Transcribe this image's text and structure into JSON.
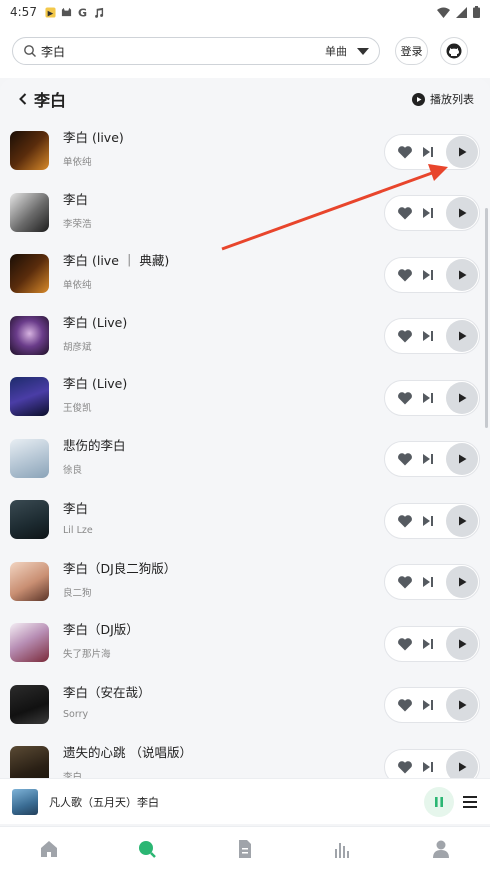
{
  "status_bar": {
    "time": "4:57",
    "notification_icons": [
      "notification-badge-icon",
      "cat-icon",
      "google-icon",
      "music-note-icon"
    ],
    "system_icons": [
      "wifi-icon",
      "signal-icon",
      "battery-icon"
    ]
  },
  "search": {
    "query": "李白",
    "type_label": "单曲"
  },
  "header": {
    "login_label": "登录"
  },
  "panel": {
    "title": "李白",
    "playlist_label": "播放列表"
  },
  "songs": [
    {
      "title": "李白 (live)",
      "artist": "单依纯"
    },
    {
      "title": "李白",
      "artist": "李荣浩"
    },
    {
      "title": "李白 (live ｜ 典藏)",
      "artist": "单依纯"
    },
    {
      "title": "李白 (Live)",
      "artist": "胡彦斌"
    },
    {
      "title": "李白 (Live)",
      "artist": "王俊凯"
    },
    {
      "title": "悲伤的李白",
      "artist": "徐良"
    },
    {
      "title": "李白",
      "artist": "Lil Lze"
    },
    {
      "title": "李白（DJ良二狗版）",
      "artist": "良二狗"
    },
    {
      "title": "李白（DJ版）",
      "artist": "失了那片海"
    },
    {
      "title": "李白（安在哉）",
      "artist": "Sorry"
    },
    {
      "title": "遗失的心跳 （说唱版）",
      "artist": "李白"
    }
  ],
  "now_playing": {
    "title": "凡人歌（五月天）李白"
  },
  "colors": {
    "accent": "#2bb673",
    "annotation_arrow": "#e8452c",
    "play_button_bg": "#d9dce0",
    "icon_gray": "#555a60"
  },
  "bottom_nav": [
    "home-icon",
    "discover-icon",
    "document-icon",
    "charts-icon",
    "profile-icon"
  ]
}
